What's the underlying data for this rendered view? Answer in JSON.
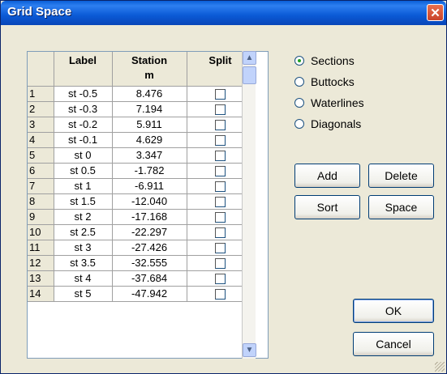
{
  "window": {
    "title": "Grid Space",
    "close_glyph": "✕"
  },
  "grid": {
    "columns": {
      "label": "Label",
      "station": "Station",
      "station_unit": "m",
      "split": "Split"
    },
    "rows": [
      {
        "n": "1",
        "label": "st -0.5",
        "station": "8.476"
      },
      {
        "n": "2",
        "label": "st -0.3",
        "station": "7.194"
      },
      {
        "n": "3",
        "label": "st -0.2",
        "station": "5.911"
      },
      {
        "n": "4",
        "label": "st -0.1",
        "station": "4.629"
      },
      {
        "n": "5",
        "label": "st 0",
        "station": "3.347"
      },
      {
        "n": "6",
        "label": "st 0.5",
        "station": "-1.782"
      },
      {
        "n": "7",
        "label": "st 1",
        "station": "-6.911"
      },
      {
        "n": "8",
        "label": "st 1.5",
        "station": "-12.040"
      },
      {
        "n": "9",
        "label": "st 2",
        "station": "-17.168"
      },
      {
        "n": "10",
        "label": "st 2.5",
        "station": "-22.297"
      },
      {
        "n": "11",
        "label": "st 3",
        "station": "-27.426"
      },
      {
        "n": "12",
        "label": "st 3.5",
        "station": "-32.555"
      },
      {
        "n": "13",
        "label": "st 4",
        "station": "-37.684"
      },
      {
        "n": "14",
        "label": "st 5",
        "station": "-47.942"
      }
    ]
  },
  "options": {
    "items": [
      {
        "label": "Sections",
        "checked": true
      },
      {
        "label": "Buttocks",
        "checked": false
      },
      {
        "label": "Waterlines",
        "checked": false
      },
      {
        "label": "Diagonals",
        "checked": false
      }
    ]
  },
  "buttons": {
    "add": "Add",
    "delete": "Delete",
    "sort": "Sort",
    "space": "Space",
    "ok": "OK",
    "cancel": "Cancel"
  },
  "colors": {
    "title_bar": "#0A5FD8",
    "dialog_bg": "#ECE9D8",
    "radio_dot": "#21A121"
  },
  "icons": {
    "close": "close-icon",
    "scroll_up": "chevron-up-icon",
    "scroll_down": "chevron-down-icon"
  }
}
